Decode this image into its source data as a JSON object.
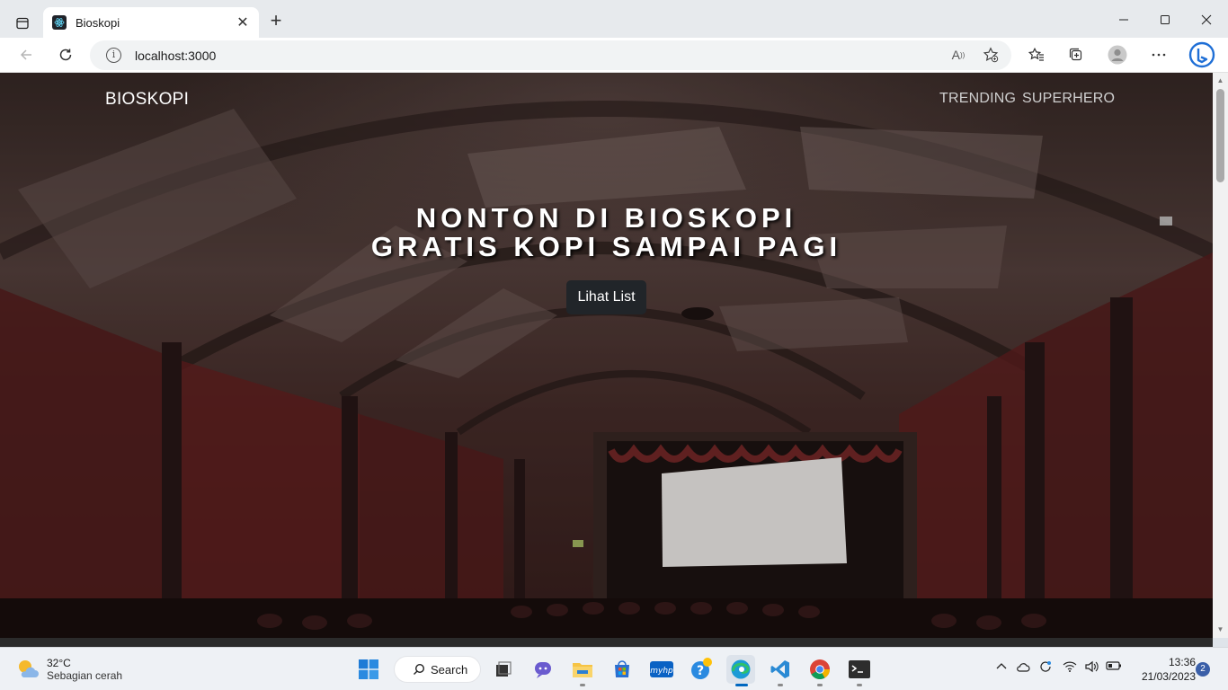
{
  "browser": {
    "tab_title": "Bioskopi",
    "url": "localhost:3000",
    "icons": [
      "tab-actions-icon",
      "react-favicon",
      "close-icon",
      "plus-icon",
      "minimize-icon",
      "maximize-icon",
      "close-window-icon",
      "back-icon",
      "refresh-icon",
      "info-icon",
      "read-aloud-icon",
      "add-favorite-icon",
      "favorites-icon",
      "collections-icon",
      "profile-icon",
      "more-icon",
      "bing-icon"
    ]
  },
  "page": {
    "brand": "BIOSKOPI",
    "nav": [
      {
        "label": "TRENDING"
      },
      {
        "label": "SUPERHERO"
      }
    ],
    "hero": {
      "title_line1": "NONTON DI BIOSKOPI",
      "title_line2": "GRATIS KOPI SAMPAI PAGI",
      "button": "Lihat List"
    }
  },
  "taskbar": {
    "weather": {
      "temp": "32°C",
      "desc": "Sebagian cerah"
    },
    "search_label": "Search",
    "clock": {
      "time": "13:36",
      "date": "21/03/2023"
    },
    "notifications": "2",
    "colors": {
      "accent": "#0078d4",
      "edge": "#1c9bd6",
      "vscode": "#2a8ad4",
      "chrome_red": "#db4437",
      "chrome_green": "#0f9d58",
      "chrome_yellow": "#f4b400"
    }
  }
}
